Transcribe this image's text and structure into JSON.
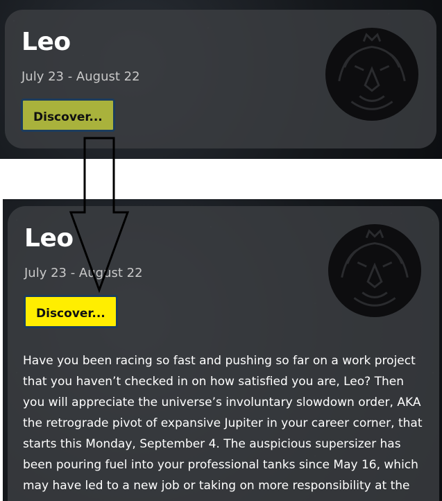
{
  "before": {
    "sign": "Leo",
    "dates": "July 23 - August 22",
    "discover_label": "Discover..."
  },
  "after": {
    "sign": "Leo",
    "dates": "July 23 - August 22",
    "discover_label": "Discover...",
    "horoscope": "Have you been racing so fast and pushing so far on a work project that you haven’t checked in on how satisfied you are, Leo? Then you will appreciate the universe’s involuntary slowdown order, AKA the retrograde pivot of expansive Jupiter in your career corner, that starts this Monday, September 4. The auspicious supersizer has been pouring fuel into your professional tanks since May 16, which may have led to a new job or taking on more responsibility at the"
  },
  "colors": {
    "button_muted": "#a9b23c",
    "button_bright": "#ffee00",
    "button_border": "#1c3c5c"
  },
  "icons": {
    "zodiac": "lion-head-icon",
    "transition": "down-arrow-icon"
  }
}
